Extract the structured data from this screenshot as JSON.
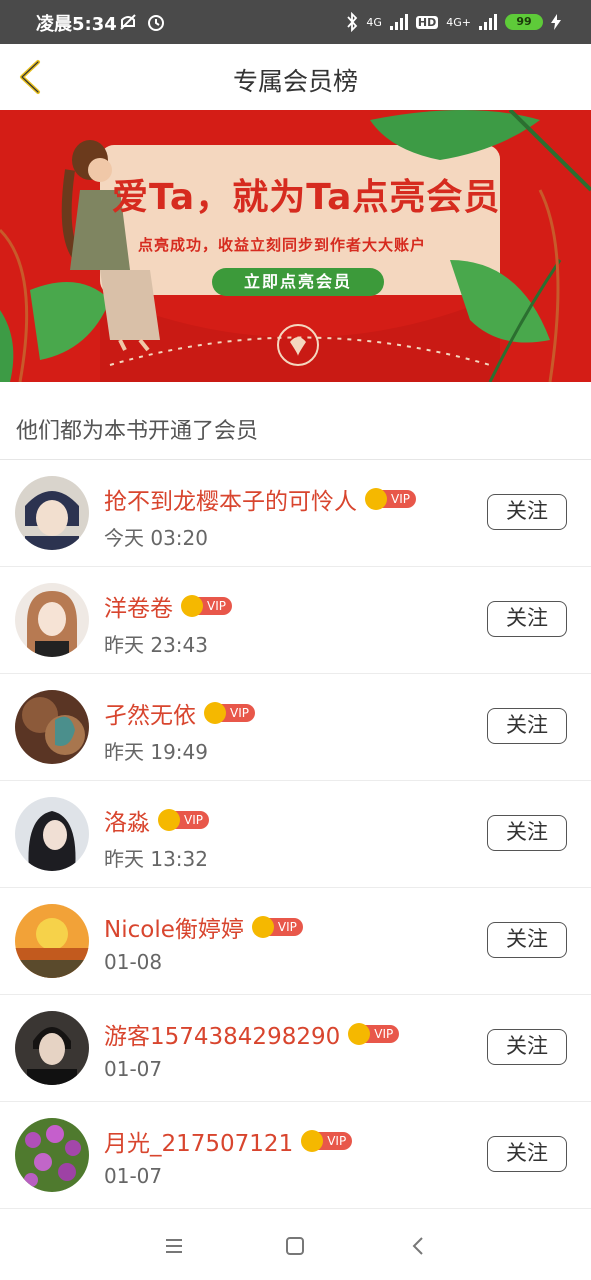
{
  "status_bar": {
    "time": "凌晨5:34",
    "battery": "99",
    "net1": "4G",
    "net2": "4G+",
    "hd": "HD"
  },
  "nav": {
    "title": "专属会员榜",
    "back_icon": "chevron-left-icon"
  },
  "banner": {
    "title": "爱Ta，就为Ta点亮会员",
    "subtitle": "点亮成功，收益立刻同步到作者大大账户",
    "button": "立即点亮会员"
  },
  "section": {
    "label": "他们都为本书开通了会员"
  },
  "members": [
    {
      "name": "抢不到龙樱本子的可怜人",
      "time": "今天 03:20",
      "badge": "VIP",
      "follow": "关注"
    },
    {
      "name": "洋卷卷",
      "time": "昨天 23:43",
      "badge": "VIP",
      "follow": "关注"
    },
    {
      "name": "孑然无依",
      "time": "昨天 19:49",
      "badge": "VIP",
      "follow": "关注"
    },
    {
      "name": "洛淼",
      "time": "昨天 13:32",
      "badge": "VIP",
      "follow": "关注"
    },
    {
      "name": "Nicole衡婷婷",
      "time": "01-08",
      "badge": "VIP",
      "follow": "关注"
    },
    {
      "name": "游客1574384298290",
      "time": "01-07",
      "badge": "VIP",
      "follow": "关注"
    },
    {
      "name": "月光_217507121",
      "time": "01-07",
      "badge": "VIP",
      "follow": "关注"
    }
  ],
  "colors": {
    "accent": "#d8452e",
    "banner_bg": "#d41d16",
    "banner_btn": "#3c9a3a"
  }
}
